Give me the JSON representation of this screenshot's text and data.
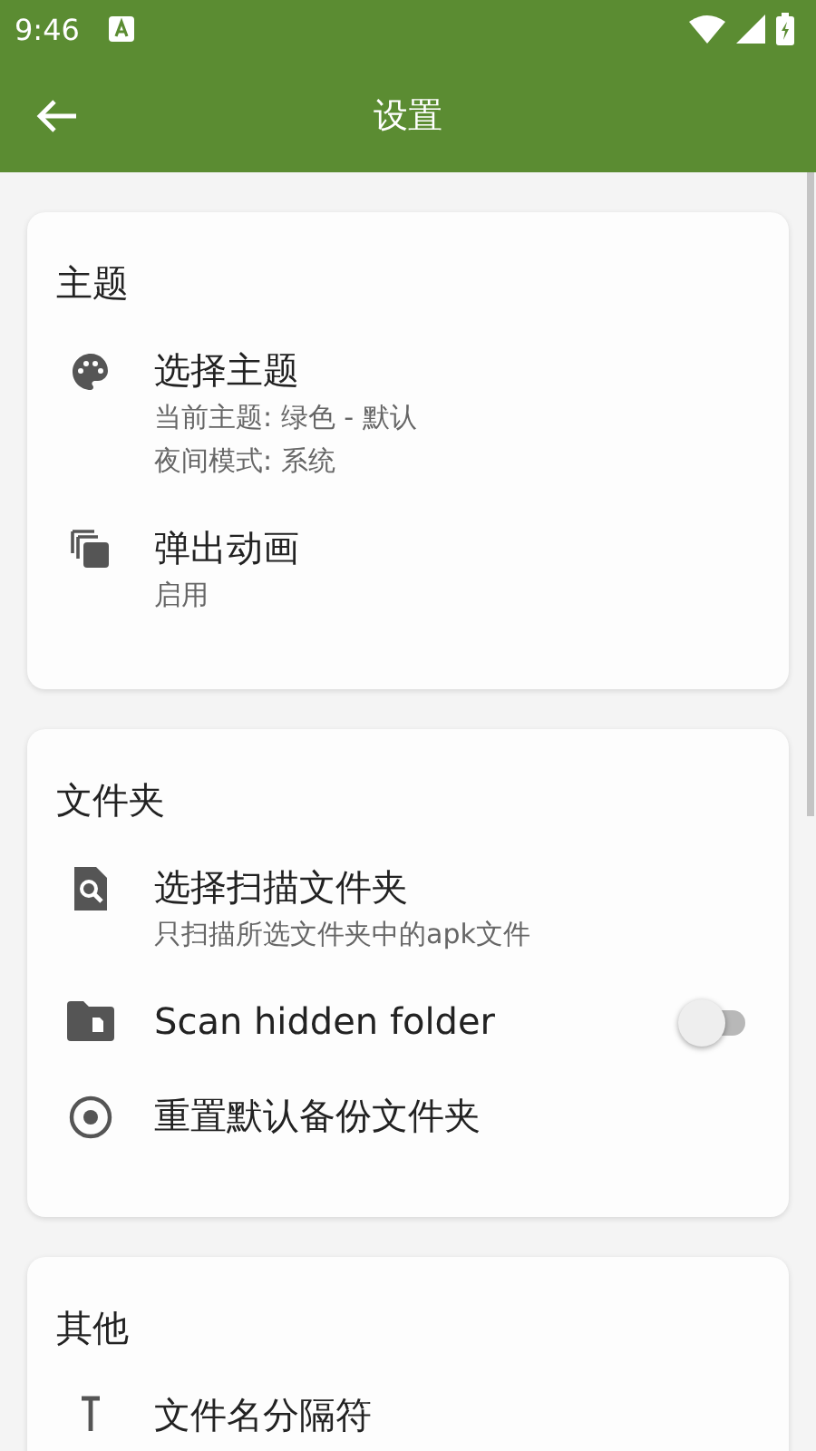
{
  "status_bar": {
    "time": "9:46"
  },
  "app_bar": {
    "title": "设置"
  },
  "sections": [
    {
      "title": "主题",
      "items": [
        {
          "kind": "plain",
          "title": "选择主题",
          "subtitles": [
            "当前主题: 绿色 - 默认",
            "夜间模式: 系统"
          ]
        },
        {
          "kind": "plain",
          "title": "弹出动画",
          "subtitles": [
            "启用"
          ]
        }
      ]
    },
    {
      "title": "文件夹",
      "items": [
        {
          "kind": "plain",
          "title": "选择扫描文件夹",
          "subtitles": [
            "只扫描所选文件夹中的apk文件"
          ]
        },
        {
          "kind": "toggle",
          "title": "Scan hidden folder",
          "on": false
        },
        {
          "kind": "plain",
          "title": "重置默认备份文件夹"
        }
      ]
    },
    {
      "title": "其他",
      "items": [
        {
          "kind": "plain",
          "title": "文件名分隔符"
        }
      ]
    }
  ]
}
